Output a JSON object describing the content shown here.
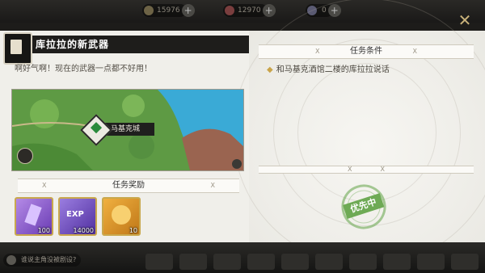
{
  "topbar": {
    "resource1": "15976",
    "resource2": "12970",
    "resource3": "0"
  },
  "quest": {
    "title": "库拉拉的新武器",
    "description": "啊好气啊！现在的武器一点都不好用！"
  },
  "map": {
    "location_label": "马基克城"
  },
  "rewards": {
    "header": "任务奖励",
    "items": [
      {
        "name": "purple-crystal-icon",
        "qty": "100"
      },
      {
        "name": "exp-crystal-icon",
        "label": "EXP",
        "qty": "14000"
      },
      {
        "name": "gold-token-icon",
        "qty": "10"
      }
    ]
  },
  "conditions": {
    "header": "任务条件",
    "items": [
      "和马基克酒馆二楼的库拉拉说话"
    ]
  },
  "status_stamp": "优先中",
  "chat": {
    "placeholder": "谁说主角没被剧设?"
  },
  "colors": {
    "reward_border": "#c9a84d",
    "stamp_green": "#6eaa55",
    "diamond_gold": "#c9a44a"
  }
}
